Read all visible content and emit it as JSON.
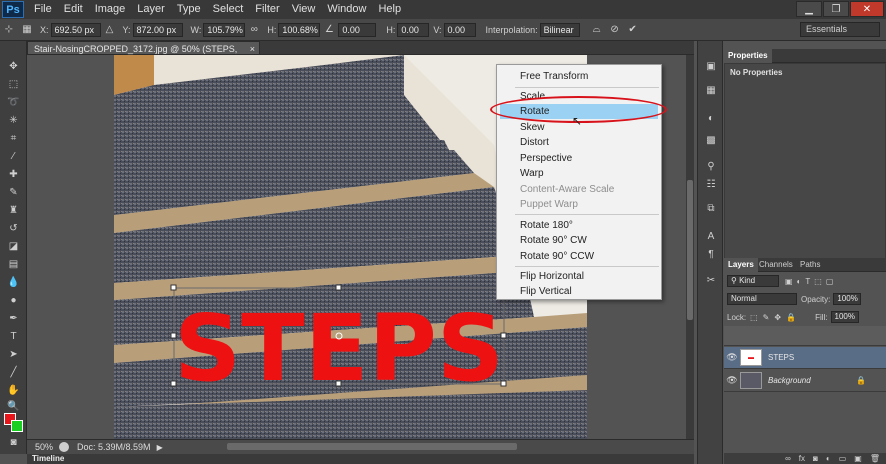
{
  "app": {
    "logo": "Ps"
  },
  "menu": [
    "File",
    "Edit",
    "Image",
    "Layer",
    "Type",
    "Select",
    "Filter",
    "View",
    "Window",
    "Help"
  ],
  "window_controls": {
    "minimize": "▁",
    "restore": "❐",
    "close": "✕"
  },
  "options": {
    "x_label": "X:",
    "x_value": "692.50 px",
    "y_label": "Y:",
    "y_value": "872.00 px",
    "w_label": "W:",
    "w_value": "105.79%",
    "h_label": "H:",
    "h_value": "100.68%",
    "angle_value": "0.00",
    "hskew_label": "H:",
    "hskew_value": "0.00",
    "vskew_label": "V:",
    "vskew_value": "0.00",
    "interp_label": "Interpolation:",
    "interp_value": "Bilinear",
    "workspace": "Essentials"
  },
  "document": {
    "tab_title": "Stair-NosingCROPPED_3172.jpg @ 50% (STEPS, RGB/8*) *",
    "close_glyph": "×",
    "text_layer_content": "STEPS"
  },
  "status": {
    "zoom": "50%",
    "doc": "Doc: 5.39M/8.59M"
  },
  "timeline_label": "Timeline",
  "context_menu": {
    "items": [
      {
        "label": "Free Transform",
        "disabled": false
      },
      {
        "label": "Scale",
        "disabled": false
      },
      {
        "label": "Rotate",
        "disabled": false,
        "highlighted": true
      },
      {
        "label": "Skew",
        "disabled": false
      },
      {
        "label": "Distort",
        "disabled": false
      },
      {
        "label": "Perspective",
        "disabled": false
      },
      {
        "label": "Warp",
        "disabled": false
      },
      {
        "label": "Content-Aware Scale",
        "disabled": true
      },
      {
        "label": "Puppet Warp",
        "disabled": true
      },
      {
        "label": "Rotate 180°",
        "disabled": false
      },
      {
        "label": "Rotate 90° CW",
        "disabled": false
      },
      {
        "label": "Rotate 90° CCW",
        "disabled": false
      },
      {
        "label": "Flip Horizontal",
        "disabled": false
      },
      {
        "label": "Flip Vertical",
        "disabled": false
      }
    ]
  },
  "properties": {
    "tab": "Properties",
    "body": "No Properties"
  },
  "layers_panel": {
    "tabs": [
      "Layers",
      "Channels",
      "Paths"
    ],
    "filter_label": "Kind",
    "blend_mode": "Normal",
    "opacity_label": "Opacity:",
    "opacity_value": "100%",
    "lock_label": "Lock:",
    "fill_label": "Fill:",
    "fill_value": "100%",
    "layers": [
      {
        "name": "STEPS",
        "selected": true
      },
      {
        "name": "Background",
        "selected": false
      }
    ],
    "footer_icons": [
      "link-icon",
      "fx-icon",
      "mask-icon",
      "adjustment-icon",
      "folder-icon",
      "new-layer-icon",
      "trash-icon"
    ]
  },
  "colors": {
    "foreground": "#e8151b",
    "background": "#1bcf22",
    "highlight": "#9bd1f3",
    "annotation": "#d8121a"
  }
}
